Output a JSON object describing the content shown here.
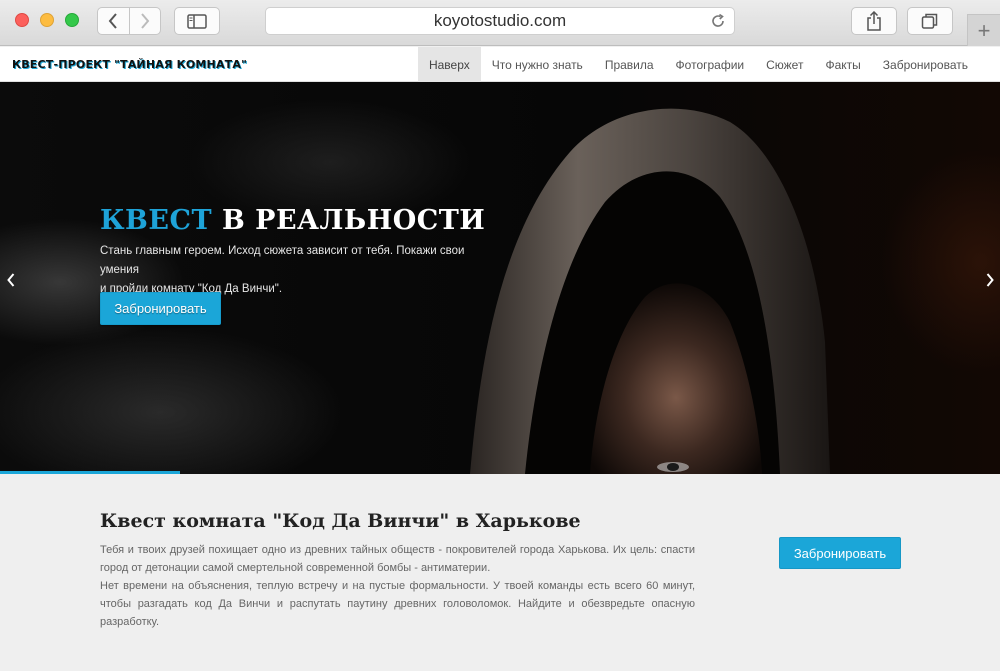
{
  "browser": {
    "url": "koyotostudio.com",
    "icons": [
      "back-icon",
      "forward-icon",
      "sidebar-icon",
      "reload-icon",
      "share-icon",
      "tabs-icon",
      "plus-icon"
    ]
  },
  "site": {
    "logo": "КВЕСТ-ПРОЕКТ \"ТАЙНАЯ КОМНАТА\"",
    "menu": [
      {
        "label": "Наверх",
        "active": true
      },
      {
        "label": "Что нужно знать",
        "active": false
      },
      {
        "label": "Правила",
        "active": false
      },
      {
        "label": "Фотографии",
        "active": false
      },
      {
        "label": "Сюжет",
        "active": false
      },
      {
        "label": "Факты",
        "active": false
      },
      {
        "label": "Забронировать",
        "active": false
      }
    ]
  },
  "hero": {
    "title_accent": "КВЕСТ",
    "title_rest": " В РЕАЛЬНОСТИ",
    "text_line1": "Стань главным героем. Исход сюжета зависит от тебя. Покажи свои умения",
    "text_line2": "и пройди комнату \"Код Да Винчи\".",
    "button": "Забронировать",
    "slide_progress": 0.18,
    "accent_color": "#1ba6d8"
  },
  "content": {
    "title": "Квест комната \"Код Да Винчи\" в Харькове",
    "paragraph1": "Тебя и твоих друзей похищает одно из древних тайных обществ - покровителей города Харькова. Их цель: спасти город от детонации самой смертельной современной бомбы - антиматерии.",
    "paragraph2": "Нет времени на объяснения, теплую встречу и на пустые формальности. У твоей команды есть всего 60 минут, чтобы разгадать код Да Винчи и распутать паутину древних головоломок. Найдите и обезвредьте опасную разработку.",
    "button": "Забронировать"
  }
}
